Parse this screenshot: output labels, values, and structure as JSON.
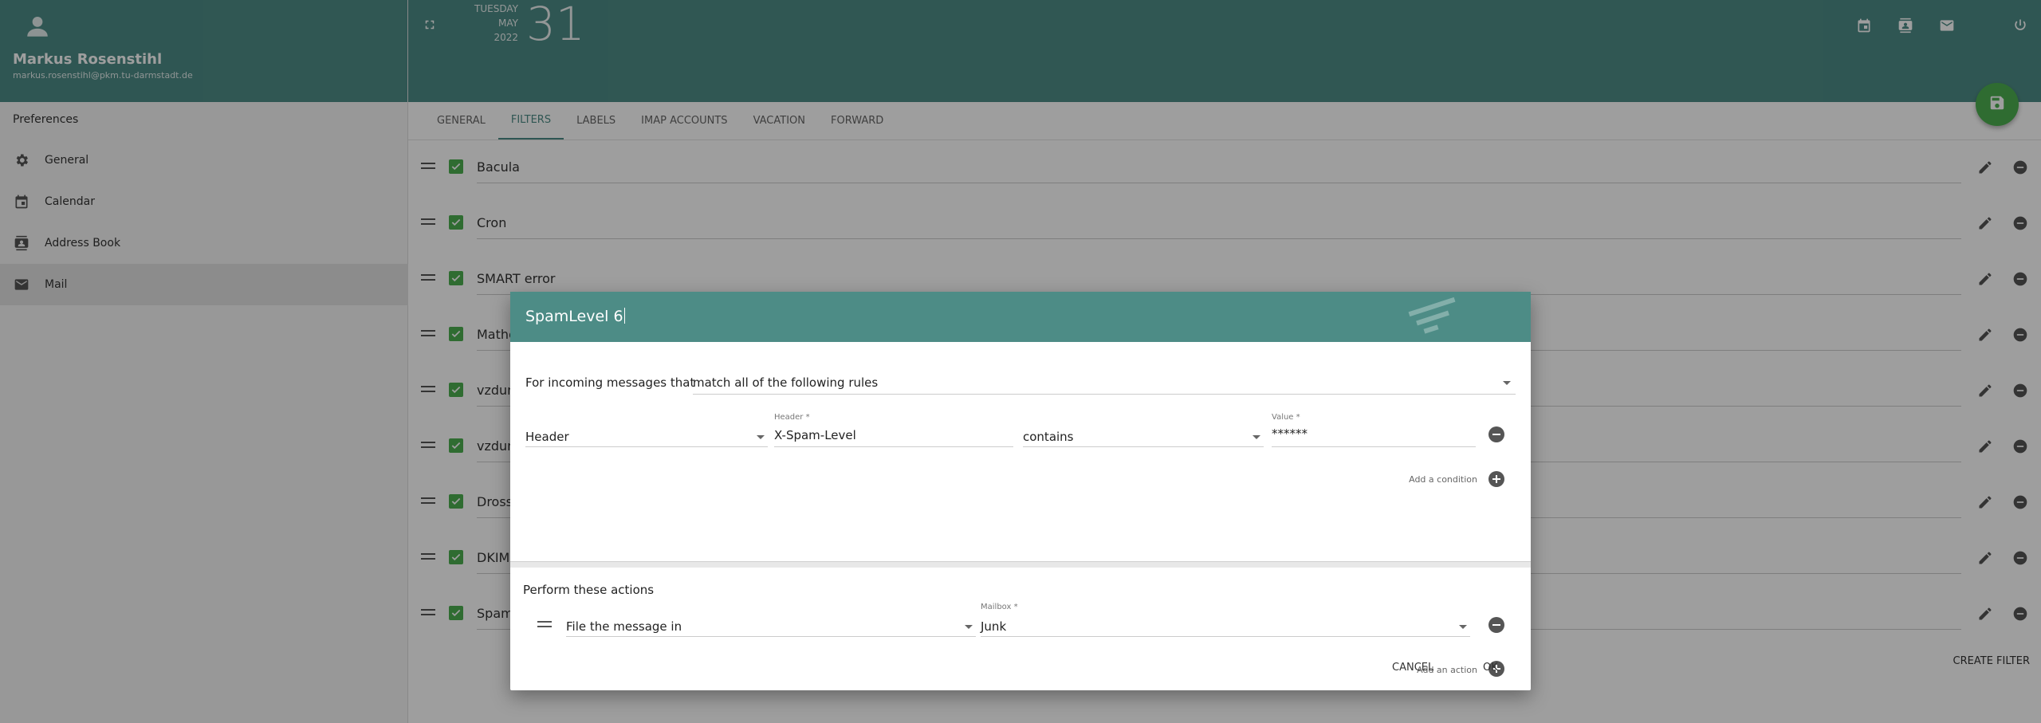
{
  "user": {
    "name": "Markus Rosenstihl",
    "email": "markus.rosenstihl@pkm.tu-darmstadt.de"
  },
  "date": {
    "weekday": "TUESDAY",
    "month": "MAY",
    "year": "2022",
    "day": "31"
  },
  "sidebar": {
    "title": "Preferences",
    "items": [
      {
        "label": "General",
        "icon": "gear-icon"
      },
      {
        "label": "Calendar",
        "icon": "calendar-icon"
      },
      {
        "label": "Address Book",
        "icon": "contacts-icon"
      },
      {
        "label": "Mail",
        "icon": "mail-icon",
        "active": true
      }
    ]
  },
  "tabs": [
    "GENERAL",
    "FILTERS",
    "LABELS",
    "IMAP ACCOUNTS",
    "VACATION",
    "FORWARD"
  ],
  "filters": [
    "Bacula",
    "Cron",
    "SMART error",
    "Mathe",
    "vzdun",
    "vzdun",
    "Dross",
    "DKIM",
    "Spam"
  ],
  "create_filter": "CREATE FILTER",
  "dialog": {
    "title": "SpamLevel 6",
    "incoming_label": "For incoming messages that",
    "match_value": "match all of the following rules",
    "condition": {
      "field": "Header",
      "header_label": "Header *",
      "header_value": "X-Spam-Level",
      "operator": "contains",
      "value_label": "Value *",
      "value": "******"
    },
    "add_condition": "Add a condition",
    "actions_title": "Perform these actions",
    "action": {
      "type": "File the message in",
      "mailbox_label": "Mailbox *",
      "mailbox": "Junk"
    },
    "add_action": "Add an action",
    "cancel": "CANCEL",
    "ok": "OK"
  },
  "colors": {
    "primary": "#4d8c86",
    "accent": "#4caf50"
  }
}
